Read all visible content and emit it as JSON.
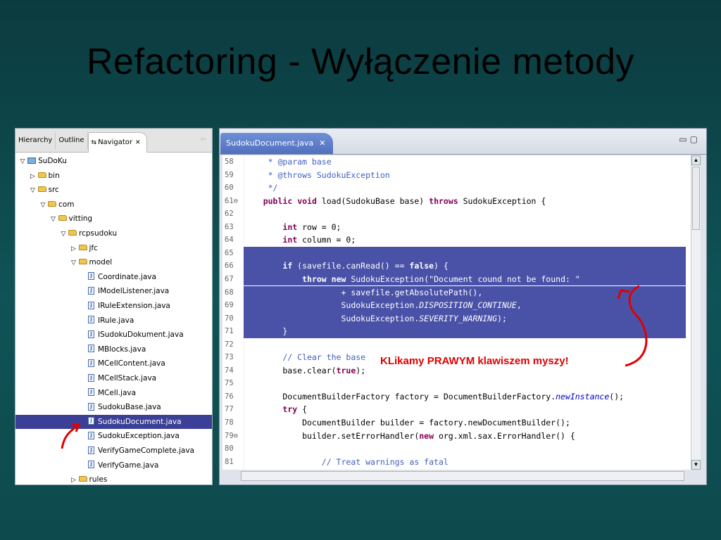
{
  "slide": {
    "title": "Refactoring - Wyłączenie metody"
  },
  "navigator": {
    "tabs": [
      {
        "label": "Hierarchy"
      },
      {
        "label": "Outline"
      },
      {
        "label": "Navigator",
        "active": true
      }
    ],
    "tree": [
      {
        "label": "SuDoKu",
        "depth": 0,
        "twisty": "open",
        "icon": "project"
      },
      {
        "label": "bin",
        "depth": 1,
        "twisty": "closed",
        "icon": "folder"
      },
      {
        "label": "src",
        "depth": 1,
        "twisty": "open",
        "icon": "folder"
      },
      {
        "label": "com",
        "depth": 2,
        "twisty": "open",
        "icon": "folder"
      },
      {
        "label": "vitting",
        "depth": 3,
        "twisty": "open",
        "icon": "folder"
      },
      {
        "label": "rcpsudoku",
        "depth": 4,
        "twisty": "open",
        "icon": "folder"
      },
      {
        "label": "jfc",
        "depth": 5,
        "twisty": "closed",
        "icon": "folder"
      },
      {
        "label": "model",
        "depth": 5,
        "twisty": "open",
        "icon": "folder"
      },
      {
        "label": "Coordinate.java",
        "depth": 6,
        "twisty": "none",
        "icon": "java"
      },
      {
        "label": "IModelListener.java",
        "depth": 6,
        "twisty": "none",
        "icon": "java"
      },
      {
        "label": "IRuleExtension.java",
        "depth": 6,
        "twisty": "none",
        "icon": "java"
      },
      {
        "label": "IRule.java",
        "depth": 6,
        "twisty": "none",
        "icon": "java"
      },
      {
        "label": "ISudokuDokument.java",
        "depth": 6,
        "twisty": "none",
        "icon": "java"
      },
      {
        "label": "MBlocks.java",
        "depth": 6,
        "twisty": "none",
        "icon": "java"
      },
      {
        "label": "MCellContent.java",
        "depth": 6,
        "twisty": "none",
        "icon": "java"
      },
      {
        "label": "MCellStack.java",
        "depth": 6,
        "twisty": "none",
        "icon": "java"
      },
      {
        "label": "MCell.java",
        "depth": 6,
        "twisty": "none",
        "icon": "java"
      },
      {
        "label": "SudokuBase.java",
        "depth": 6,
        "twisty": "none",
        "icon": "java"
      },
      {
        "label": "SudokuDocument.java",
        "depth": 6,
        "twisty": "none",
        "icon": "java",
        "selected": true
      },
      {
        "label": "SudokuException.java",
        "depth": 6,
        "twisty": "none",
        "icon": "java"
      },
      {
        "label": "VerifyGameComplete.java",
        "depth": 6,
        "twisty": "none",
        "icon": "java"
      },
      {
        "label": "VerifyGame.java",
        "depth": 6,
        "twisty": "none",
        "icon": "java"
      },
      {
        "label": "rules",
        "depth": 5,
        "twisty": "closed",
        "icon": "folder"
      }
    ]
  },
  "editor": {
    "tab_label": "SudokuDocument.java",
    "annotation": "KLikamy PRAWYM klawiszem myszy!",
    "lines": [
      {
        "n": "58",
        "text": "     * @param base"
      },
      {
        "n": "59",
        "text": "     * @throws SudokuException"
      },
      {
        "n": "60",
        "text": "     */"
      },
      {
        "n": "61",
        "text": "    public void load(SudokuBase base) throws SudokuException {"
      },
      {
        "n": "62",
        "text": ""
      },
      {
        "n": "63",
        "text": "        int row = 0;"
      },
      {
        "n": "64",
        "text": "        int column = 0;"
      },
      {
        "n": "65",
        "text": ""
      },
      {
        "n": "66",
        "text": "        if (savefile.canRead() == false) {"
      },
      {
        "n": "67",
        "text": "            throw new SudokuException(\"Document cound not be found: \""
      },
      {
        "n": "68",
        "text": "                    + savefile.getAbsolutePath(),"
      },
      {
        "n": "69",
        "text": "                    SudokuException.DISPOSITION_CONTINUE,"
      },
      {
        "n": "70",
        "text": "                    SudokuException.SEVERITY_WARNING);"
      },
      {
        "n": "71",
        "text": "        }"
      },
      {
        "n": "72",
        "text": ""
      },
      {
        "n": "73",
        "text": "        // Clear the base"
      },
      {
        "n": "74",
        "text": "        base.clear(true);"
      },
      {
        "n": "75",
        "text": ""
      },
      {
        "n": "76",
        "text": "        DocumentBuilderFactory factory = DocumentBuilderFactory.newInstance();"
      },
      {
        "n": "77",
        "text": "        try {"
      },
      {
        "n": "78",
        "text": "            DocumentBuilder builder = factory.newDocumentBuilder();"
      },
      {
        "n": "79",
        "text": "            builder.setErrorHandler(new org.xml.sax.ErrorHandler() {"
      },
      {
        "n": "80",
        "text": ""
      },
      {
        "n": "81",
        "text": "                // Treat warnings as fatal"
      }
    ],
    "selected_lines": [
      "65",
      "66",
      "67",
      "68",
      "69",
      "70",
      "71"
    ],
    "fold_markers": [
      "61",
      "79"
    ]
  },
  "colors": {
    "selection": "#4a52a8",
    "tree_selection": "#3b3f95",
    "annotation_red": "#e00000"
  }
}
